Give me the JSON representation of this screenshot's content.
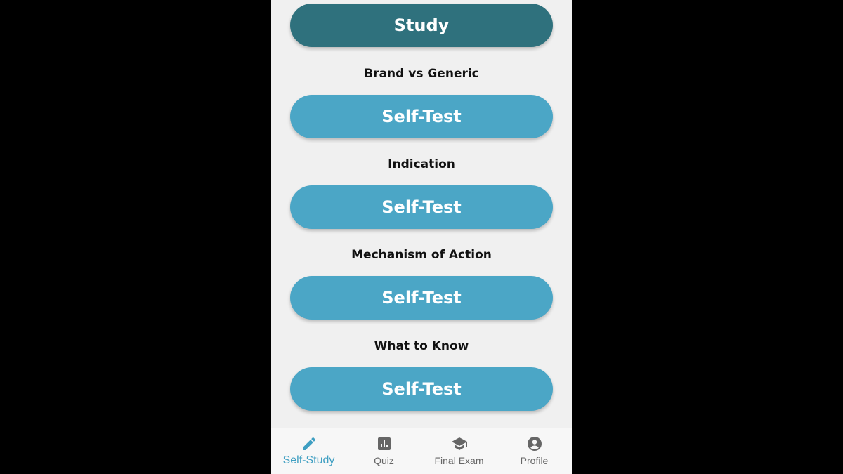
{
  "study_button": {
    "label": "Study"
  },
  "sections": [
    {
      "title": "Brand vs Generic",
      "button_label": "Self-Test"
    },
    {
      "title": "Indication",
      "button_label": "Self-Test"
    },
    {
      "title": "Mechanism of Action",
      "button_label": "Self-Test"
    },
    {
      "title": "What to Know",
      "button_label": "Self-Test"
    }
  ],
  "tabbar": {
    "active_color": "#3f9fc2",
    "inactive_color": "#666666",
    "items": [
      {
        "label": "Self-Study",
        "icon": "pencil-icon",
        "active": true
      },
      {
        "label": "Quiz",
        "icon": "bar-chart-icon",
        "active": false
      },
      {
        "label": "Final Exam",
        "icon": "graduation-cap-icon",
        "active": false
      },
      {
        "label": "Profile",
        "icon": "user-circle-icon",
        "active": false
      }
    ]
  },
  "colors": {
    "study_button": "#2f717d",
    "self_test_button": "#4ba6c6",
    "background": "#f0f0f0"
  }
}
